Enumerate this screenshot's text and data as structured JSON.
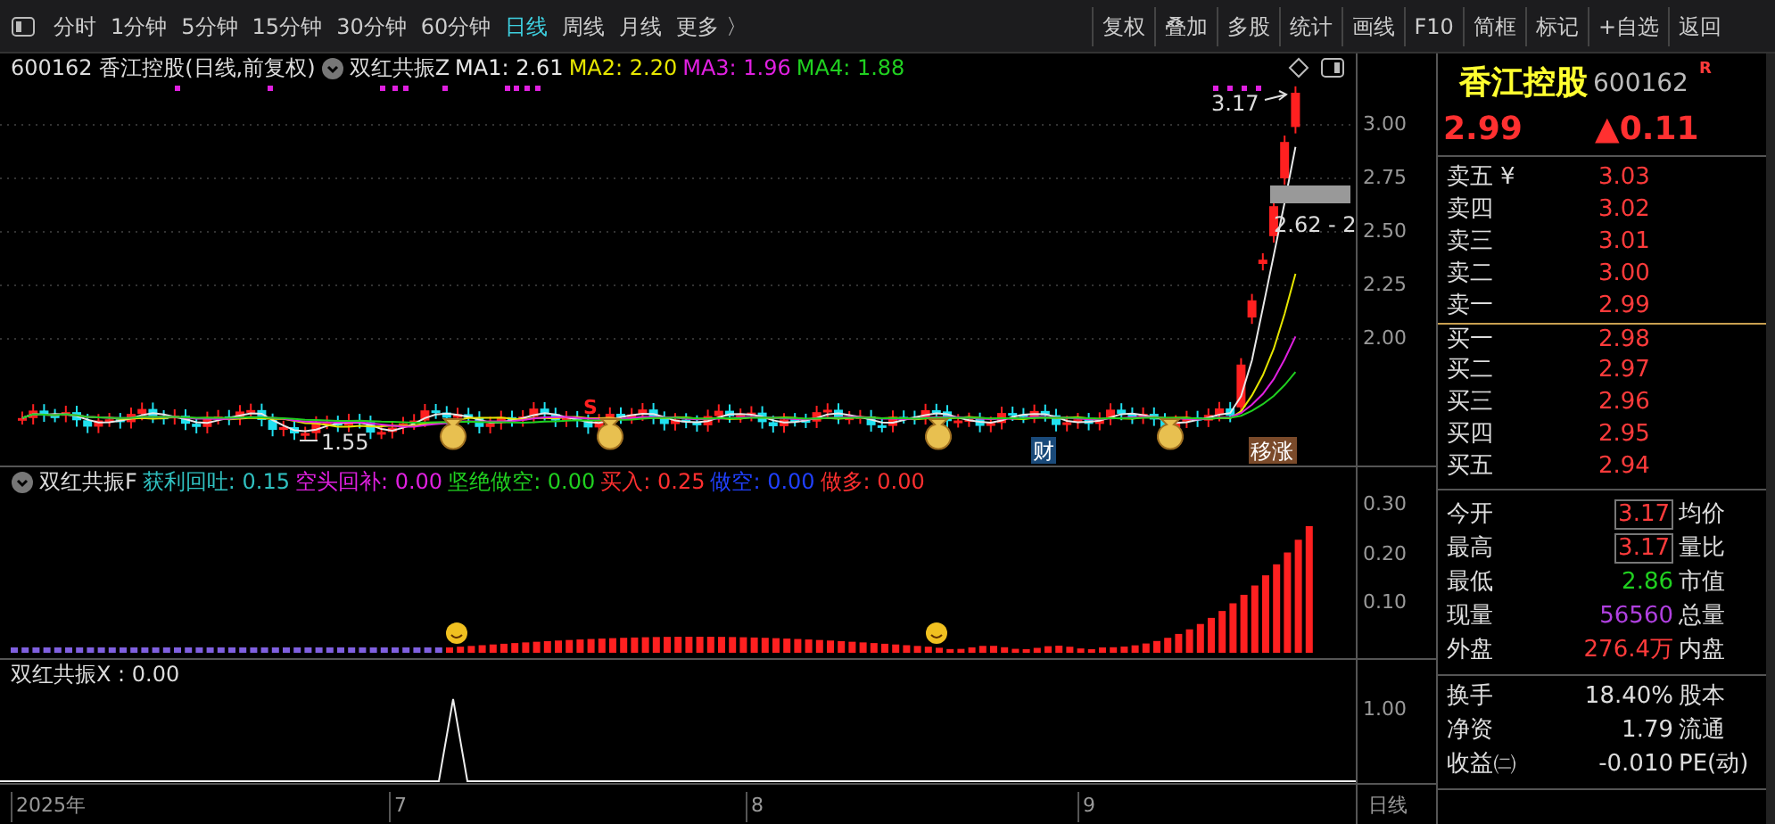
{
  "toolbar": {
    "periods": [
      {
        "label": "分时",
        "selected": false
      },
      {
        "label": "1分钟",
        "selected": false
      },
      {
        "label": "5分钟",
        "selected": false
      },
      {
        "label": "15分钟",
        "selected": false
      },
      {
        "label": "30分钟",
        "selected": false
      },
      {
        "label": "60分钟",
        "selected": false
      },
      {
        "label": "日线",
        "selected": true
      },
      {
        "label": "周线",
        "selected": false
      },
      {
        "label": "月线",
        "selected": false
      },
      {
        "label": "更多 〉",
        "selected": false
      }
    ],
    "buttons": [
      "复权",
      "叠加",
      "多股",
      "统计",
      "画线",
      "F10",
      "简框",
      "标记",
      "+自选",
      "返回"
    ]
  },
  "main_chart": {
    "title": "600162 香江控股(日线,前复权)",
    "indicator": "双红共振Z",
    "legend": [
      {
        "text": "MA1: 2.61",
        "color": "#e8e8e8"
      },
      {
        "text": "MA2: 2.20",
        "color": "#e6e600"
      },
      {
        "text": "MA3: 1.96",
        "color": "#e020e0"
      },
      {
        "text": "MA4: 1.88",
        "color": "#20d020"
      }
    ],
    "labels": {
      "high": "3.17",
      "range": "2.62 - 2",
      "low": "1.55",
      "signal": "S",
      "event": "财",
      "tag": "移涨"
    },
    "yaxis": [
      "3.00",
      "2.75",
      "2.50",
      "2.25",
      "2.00"
    ]
  },
  "indicator_f": {
    "name": "双红共振F",
    "legend": [
      {
        "text": "获利回吐: 0.15",
        "color": "#30c0c0"
      },
      {
        "text": "空头回补: 0.00",
        "color": "#e020e0"
      },
      {
        "text": "坚绝做空: 0.00",
        "color": "#20d020"
      },
      {
        "text": "买入: 0.25",
        "color": "#ff3030"
      },
      {
        "text": "做空: 0.00",
        "color": "#2040ff"
      },
      {
        "text": "做多: 0.00",
        "color": "#ff3030"
      }
    ],
    "yaxis": [
      "0.30",
      "0.20",
      "0.10"
    ]
  },
  "indicator_x": {
    "name": "双红共振X : 0.00",
    "yaxis": [
      "1.00"
    ]
  },
  "date_axis": [
    "2025年",
    "7",
    "8",
    "9"
  ],
  "period_label": "日线",
  "quote": {
    "name": "香江控股",
    "code": "600162",
    "badge": "R",
    "price": "2.99",
    "change": "▲0.11",
    "currency": "¥",
    "asks": [
      {
        "label": "卖五",
        "price": "3.03"
      },
      {
        "label": "卖四",
        "price": "3.02"
      },
      {
        "label": "卖三",
        "price": "3.01"
      },
      {
        "label": "卖二",
        "price": "3.00"
      },
      {
        "label": "卖一",
        "price": "2.99"
      }
    ],
    "bids": [
      {
        "label": "买一",
        "price": "2.98"
      },
      {
        "label": "买二",
        "price": "2.97"
      },
      {
        "label": "买三",
        "price": "2.96"
      },
      {
        "label": "买四",
        "price": "2.95"
      },
      {
        "label": "买五",
        "price": "2.94"
      }
    ],
    "stats": [
      {
        "label": "今开",
        "value": "3.17",
        "color": "#ff3b3b",
        "boxed": true,
        "label2": "均价"
      },
      {
        "label": "最高",
        "value": "3.17",
        "color": "#ff3b3b",
        "boxed": true,
        "label2": "量比"
      },
      {
        "label": "最低",
        "value": "2.86",
        "color": "#20d020",
        "boxed": false,
        "label2": "市值"
      },
      {
        "label": "现量",
        "value": "56560",
        "color": "#b040e0",
        "boxed": false,
        "label2": "总量"
      },
      {
        "label": "外盘",
        "value": "276.4万",
        "color": "#ff3b3b",
        "boxed": false,
        "label2": "内盘"
      }
    ],
    "stats2": [
      {
        "label": "换手",
        "value": "18.40%",
        "label2": "股本"
      },
      {
        "label": "净资",
        "value": "1.79",
        "label2": "流通"
      },
      {
        "label": "收益㈡",
        "value": "-0.010",
        "label2": "PE(动)"
      }
    ]
  }
}
